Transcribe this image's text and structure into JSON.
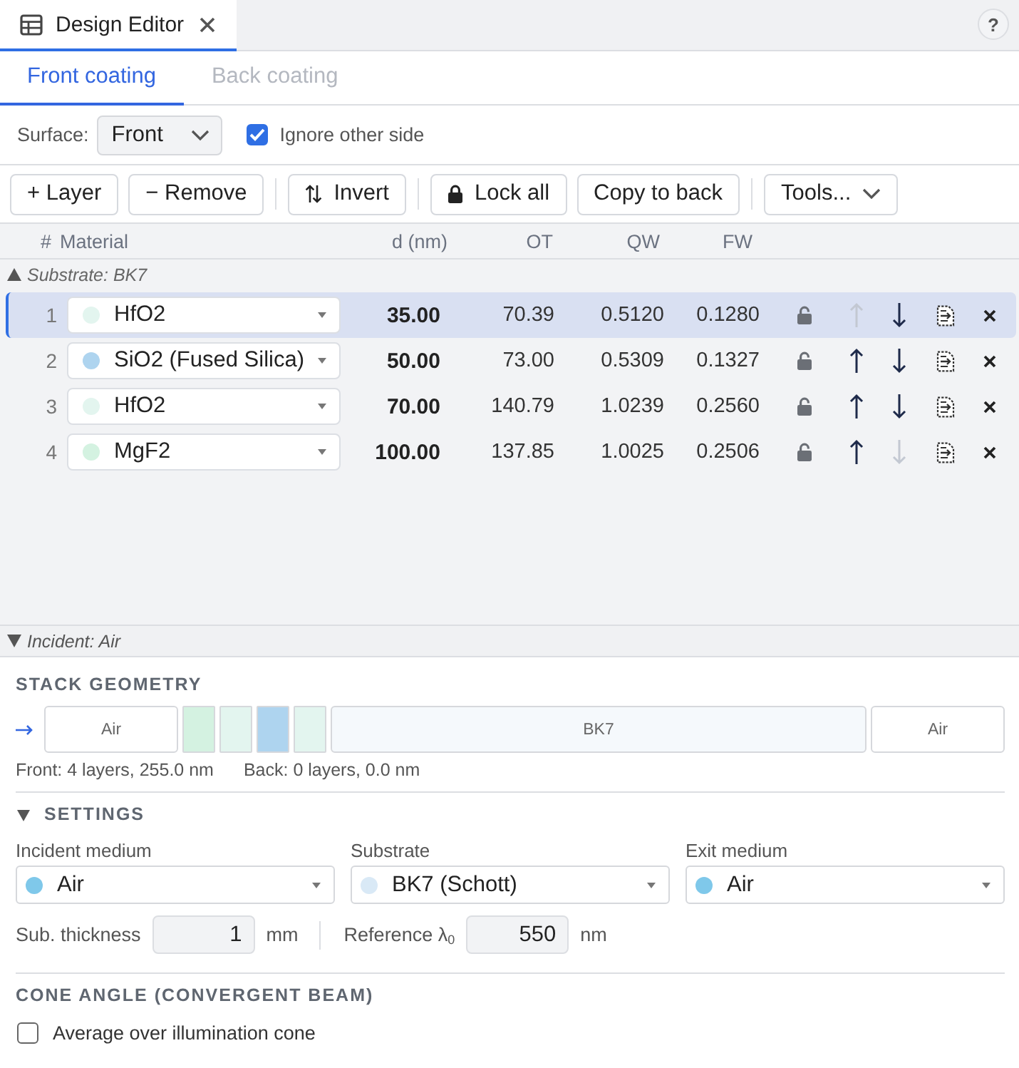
{
  "tab_bar": {
    "tabs": [
      {
        "label": "Design Editor",
        "selected": true
      }
    ],
    "help_button": "?"
  },
  "coating_tabs": [
    {
      "label": "Front coating",
      "selected": true
    },
    {
      "label": "Back coating",
      "selected": false
    }
  ],
  "surface": {
    "label": "Surface:",
    "value": "Front",
    "ignore_other_side": {
      "label": "Ignore other side",
      "checked": true
    }
  },
  "toolbar": {
    "groups": [
      {
        "buttons": [
          {
            "kind": "text",
            "label": "+ Layer"
          },
          {
            "kind": "text",
            "label": "− Remove"
          }
        ]
      },
      {
        "buttons": [
          {
            "kind": "invert",
            "label": "Invert"
          }
        ]
      },
      {
        "buttons": [
          {
            "kind": "lock",
            "label": "Lock all"
          },
          {
            "kind": "text",
            "label": "Copy to back"
          }
        ]
      },
      {
        "buttons": [
          {
            "kind": "menu",
            "label": "Tools..."
          }
        ]
      }
    ]
  },
  "table": {
    "columns": [
      "#",
      "Material",
      "d (nm)",
      "OT",
      "QW",
      "FW"
    ],
    "substrate_label": "Substrate: BK7",
    "rows": [
      {
        "number": "1",
        "material": "HfO2",
        "color": "#e3f5ef",
        "d": "35.00",
        "ot": "70.39",
        "qw": "0.5120",
        "fw": "0.1280",
        "selected": true,
        "locked": false,
        "can_move_up": false,
        "can_move_down": true
      },
      {
        "number": "2",
        "material": "SiO2 (Fused Silica)",
        "color": "#aed4ef",
        "d": "50.00",
        "ot": "73.00",
        "qw": "0.5309",
        "fw": "0.1327",
        "selected": false,
        "locked": false,
        "can_move_up": true,
        "can_move_down": true
      },
      {
        "number": "3",
        "material": "HfO2",
        "color": "#e3f5ef",
        "d": "70.00",
        "ot": "140.79",
        "qw": "1.0239",
        "fw": "0.2560",
        "selected": false,
        "locked": false,
        "can_move_up": true,
        "can_move_down": true
      },
      {
        "number": "4",
        "material": "MgF2",
        "color": "#d4f2e1",
        "d": "100.00",
        "ot": "137.85",
        "qw": "1.0025",
        "fw": "0.2506",
        "selected": false,
        "locked": false,
        "can_move_up": true,
        "can_move_down": false
      }
    ],
    "incident_label": "Incident: Air"
  },
  "stack_geometry": {
    "title": "STACK GEOMETRY",
    "segments": [
      {
        "kind": "medium",
        "label": "Air"
      },
      {
        "kind": "layer",
        "color": "#d4f2e1"
      },
      {
        "kind": "layer",
        "color": "#e3f5ef"
      },
      {
        "kind": "layer",
        "color": "#aed4ef"
      },
      {
        "kind": "layer",
        "color": "#e3f5ef"
      },
      {
        "kind": "substrate",
        "label": "BK7"
      },
      {
        "kind": "medium",
        "label": "Air"
      }
    ],
    "summary": [
      "Front: 4 layers, 255.0 nm",
      "Back: 0 layers, 0.0 nm"
    ]
  },
  "settings": {
    "title": "SETTINGS",
    "expanded": true,
    "media": [
      {
        "label": "Incident medium",
        "value": "Air",
        "color": "#7fc8ea"
      },
      {
        "label": "Substrate",
        "value": "BK7 (Schott)",
        "color": "#d9e9f6"
      },
      {
        "label": "Exit medium",
        "value": "Air",
        "color": "#7fc8ea"
      }
    ],
    "fields": [
      {
        "label": "Sub. thickness",
        "value": "1",
        "unit": "mm"
      },
      {
        "label": "Reference λ$_{0}$",
        "value": "550",
        "unit": "nm"
      }
    ]
  },
  "cone_angle": {
    "title": "CONE ANGLE (CONVERGENT BEAM)",
    "average": {
      "label": "Average over illumination cone",
      "checked": false
    }
  }
}
